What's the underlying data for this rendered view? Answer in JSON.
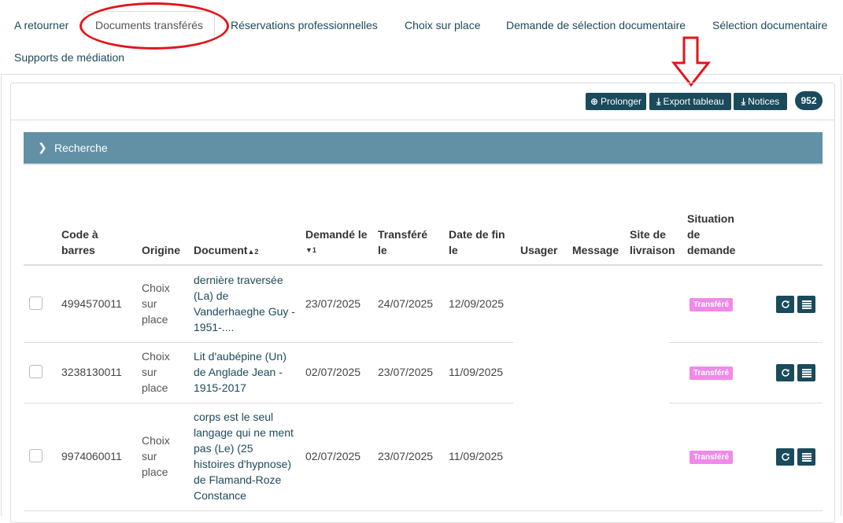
{
  "tabs": [
    {
      "label": "A retourner"
    },
    {
      "label": "Documents transférés",
      "active": true
    },
    {
      "label": "Réservations professionnelles"
    },
    {
      "label": "Choix sur place"
    },
    {
      "label": "Demande de sélection documentaire"
    },
    {
      "label": "Sélection documentaire"
    },
    {
      "label": "Supports de médiation"
    }
  ],
  "toolbar": {
    "prolonger_label": "Prolonger",
    "export_label": "Export tableau",
    "notices_label": "Notices",
    "count": "952"
  },
  "search": {
    "label": "Recherche"
  },
  "table": {
    "headers": {
      "barcode_line1": "Code à",
      "barcode_line2": "barres",
      "origin": "Origine",
      "document": "Document",
      "document_sort": "▲2",
      "requested_line1": "Demandé le",
      "requested_sort": "▼1",
      "transferred_line1": "Transféré",
      "transferred_line2": "le",
      "enddate_line1": "Date de fin",
      "enddate_line2": "le",
      "user": "Usager",
      "message": "Message",
      "site_line1": "Site de",
      "site_line2": "livraison",
      "status_line1": "Situation",
      "status_line2": "de",
      "status_line3": "demande"
    },
    "rows": [
      {
        "barcode": "4994570011",
        "origin": [
          "Choix",
          "sur",
          "place"
        ],
        "document": [
          "dernière traversée",
          "(La) de",
          "Vanderhaeghe Guy -",
          "1951-...."
        ],
        "requested": "23/07/2025",
        "transferred": "24/07/2025",
        "enddate": "12/09/2025",
        "status": "Transféré"
      },
      {
        "barcode": "3238130011",
        "origin": [
          "Choix",
          "sur",
          "place"
        ],
        "document": [
          "Lit d'aubépine (Un)",
          "de Anglade Jean -",
          "1915-2017"
        ],
        "requested": "02/07/2025",
        "transferred": "23/07/2025",
        "enddate": "11/09/2025",
        "status": "Transféré"
      },
      {
        "barcode": "9974060011",
        "origin": [
          "Choix",
          "sur",
          "place"
        ],
        "document": [
          "corps est le seul",
          "langage qui ne ment",
          "pas (Le) (25",
          "histoires d'hypnose)",
          "de Flamand-Roze",
          "Constance"
        ],
        "requested": "02/07/2025",
        "transferred": "23/07/2025",
        "enddate": "11/09/2025",
        "status": "Transféré"
      }
    ]
  },
  "icons": {
    "prolonger": "plus-circle-icon",
    "export": "download-icon",
    "notices": "download-icon",
    "search": "chevron-right-icon",
    "refresh": "refresh-icon",
    "details": "list-icon"
  },
  "colors": {
    "primary": "#1a4a5c",
    "search_bar": "#6291a6",
    "status_transfere": "#ef8ae8",
    "annotation": "#e3141b"
  }
}
